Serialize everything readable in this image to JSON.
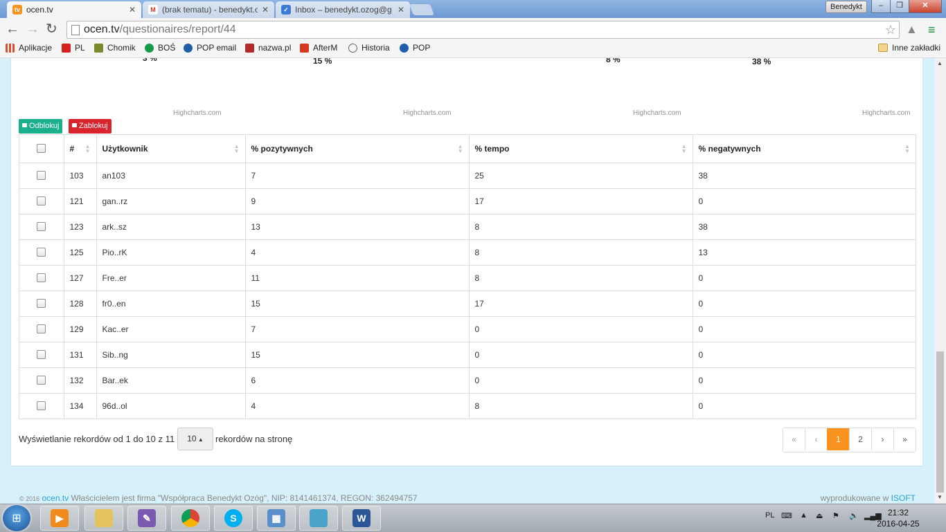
{
  "browser": {
    "tabs": [
      {
        "title": "ocen.tv",
        "icon": "tv-favicon",
        "active": true
      },
      {
        "title": "(brak tematu) - benedykt.o",
        "icon": "gmail-icon",
        "active": false
      },
      {
        "title": "Inbox – benedykt.ozog@g",
        "icon": "inbox-icon",
        "active": false
      }
    ],
    "user_badge": "Benedykt",
    "url_host": "ocen.tv",
    "url_path": "/questionaires/report/44",
    "window_buttons": {
      "minimize": "–",
      "maximize": "❐",
      "close": "✕"
    }
  },
  "bookmarks": [
    {
      "label": "Aplikacje",
      "icon": "apps-icon",
      "color": "#e04b2c"
    },
    {
      "label": "PL",
      "icon": "youtube-icon",
      "color": "#d62020"
    },
    {
      "label": "Chomik",
      "icon": "chomik-icon",
      "color": "#7a8a2a"
    },
    {
      "label": "BOŚ",
      "icon": "bos-icon",
      "color": "#169a48"
    },
    {
      "label": "POP email",
      "icon": "pop-icon",
      "color": "#1f5fa8"
    },
    {
      "label": "nazwa.pl",
      "icon": "nazwa-icon",
      "color": "#b22a2a"
    },
    {
      "label": "AfterM",
      "icon": "afterm-icon",
      "color": "#d63b1f"
    },
    {
      "label": "Historia",
      "icon": "history-icon",
      "color": "#666666"
    },
    {
      "label": "POP",
      "icon": "pop-icon",
      "color": "#1f5fa8"
    }
  ],
  "other_bookmarks": "Inne zakładki",
  "charts": {
    "labels": [
      "3 %",
      "15 %",
      "8 %",
      "38 %"
    ],
    "credits": [
      "Highcharts.com",
      "Highcharts.com",
      "Highcharts.com",
      "Highcharts.com"
    ]
  },
  "actions": {
    "unlock": "Odblokuj",
    "lock": "Zablokuj"
  },
  "table": {
    "headers": [
      "#",
      "Użytkownik",
      "% pozytywnych",
      "% tempo",
      "% negatywnych"
    ],
    "rows": [
      {
        "id": "103",
        "user": "an103",
        "pos": "7",
        "tempo": "25",
        "neg": "38"
      },
      {
        "id": "121",
        "user": "gan..rz",
        "pos": "9",
        "tempo": "17",
        "neg": "0"
      },
      {
        "id": "123",
        "user": "ark..sz",
        "pos": "13",
        "tempo": "8",
        "neg": "38"
      },
      {
        "id": "125",
        "user": "Pio..rK",
        "pos": "4",
        "tempo": "8",
        "neg": "13"
      },
      {
        "id": "127",
        "user": "Fre..er",
        "pos": "11",
        "tempo": "8",
        "neg": "0"
      },
      {
        "id": "128",
        "user": "fr0..en",
        "pos": "15",
        "tempo": "17",
        "neg": "0"
      },
      {
        "id": "129",
        "user": "Kac..er",
        "pos": "7",
        "tempo": "0",
        "neg": "0"
      },
      {
        "id": "131",
        "user": "Sib..ng",
        "pos": "15",
        "tempo": "0",
        "neg": "0"
      },
      {
        "id": "132",
        "user": "Bar..ek",
        "pos": "6",
        "tempo": "0",
        "neg": "0"
      },
      {
        "id": "134",
        "user": "96d..ol",
        "pos": "4",
        "tempo": "8",
        "neg": "0"
      }
    ]
  },
  "pagination": {
    "info_before": "Wyświetlanie rekordów od 1 do 10 z 11",
    "page_size": "10",
    "info_after": "rekordów na stronę",
    "first": "«",
    "prev": "‹",
    "pages": [
      "1",
      "2"
    ],
    "current": "1",
    "next": "›",
    "last": "»"
  },
  "footer": {
    "copyright": "© 2016",
    "brand": "ocen.tv",
    "owner": "Właścicielem jest firma \"Współpraca Benedykt Ozóg\", NIP: 8141461374, REGON: 362494757",
    "made_by_prefix": "wyprodukowane w",
    "made_by": "ISOFT"
  },
  "taskbar": {
    "lang": "PL",
    "time": "21:32",
    "date": "2016-04-25",
    "apps": [
      "media-player-icon",
      "explorer-icon",
      "paint-icon",
      "chrome-icon",
      "skype-icon",
      "control-panel-icon",
      "photo-viewer-icon",
      "word-icon"
    ]
  }
}
